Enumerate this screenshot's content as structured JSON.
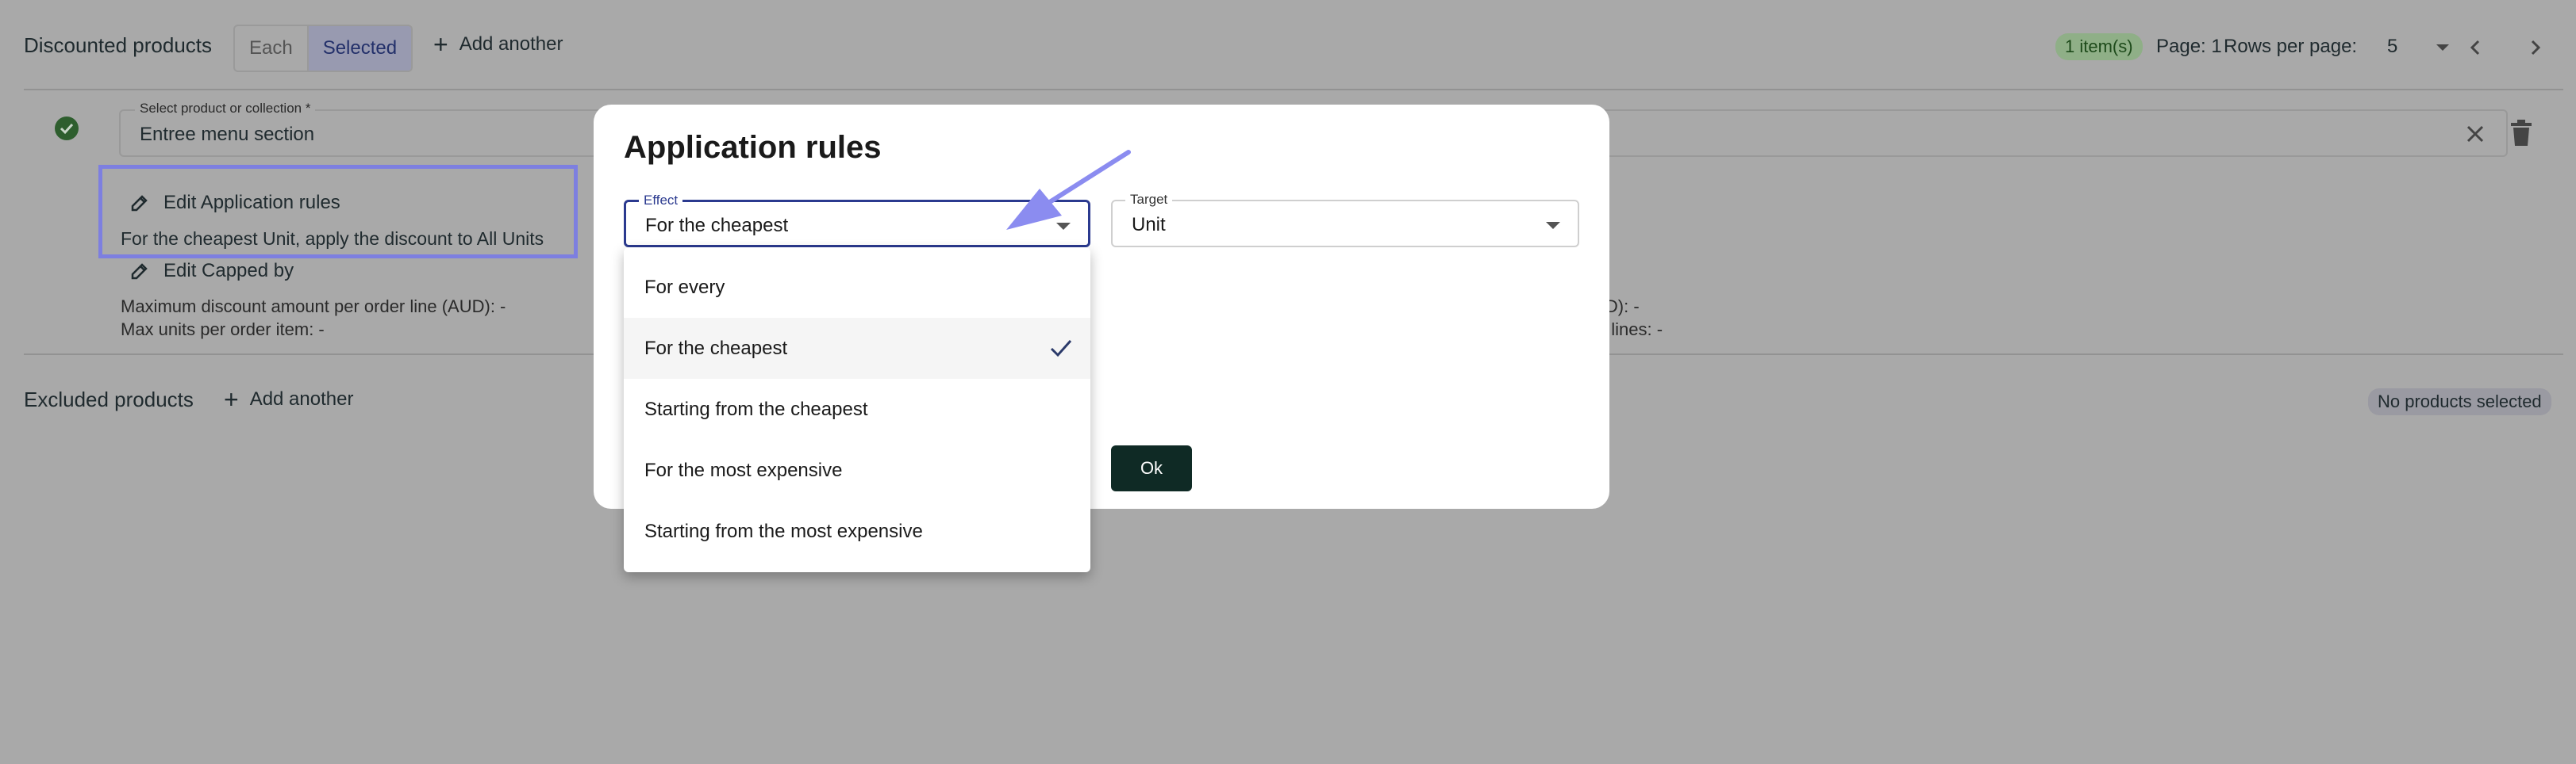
{
  "discounted": {
    "title": "Discounted products",
    "toggle": {
      "each": "Each",
      "selected": "Selected"
    },
    "add_another": "Add another",
    "count_badge": "1 item(s)",
    "page": "Page: 1",
    "rows_per_page_label": "Rows per page:",
    "rows_per_page_value": "5"
  },
  "product_row": {
    "field_label": "Select product or collection *",
    "field_value": "Entree menu section",
    "edit_rules_label": "Edit Application rules",
    "rules_summary": "For the cheapest Unit, apply the discount to All Units",
    "edit_capped_label": "Edit Capped by",
    "max_discount_line": "Maximum discount amount per order line (AUD): -",
    "max_units_line": "Max units per order item: -",
    "right_aud_text": "(AUD): -",
    "right_order_lines_text": "rder lines: -"
  },
  "excluded": {
    "title": "Excluded products",
    "add_another": "Add another",
    "status_badge": "No products selected"
  },
  "modal": {
    "title": "Application rules",
    "effect": {
      "label": "Effect",
      "value": "For the cheapest"
    },
    "target": {
      "label": "Target",
      "value": "Unit"
    },
    "ok_label": "Ok"
  },
  "effect_menu": {
    "options": [
      "For every",
      "For the cheapest",
      "Starting from the cheapest",
      "For the most expensive",
      "Starting from the most expensive"
    ],
    "selected_index": 1
  },
  "colors": {
    "accent": "#7d7fe0",
    "primary_button": "#0f2a25",
    "focus_border": "#2b3a8f",
    "success": "#2e7d32"
  }
}
